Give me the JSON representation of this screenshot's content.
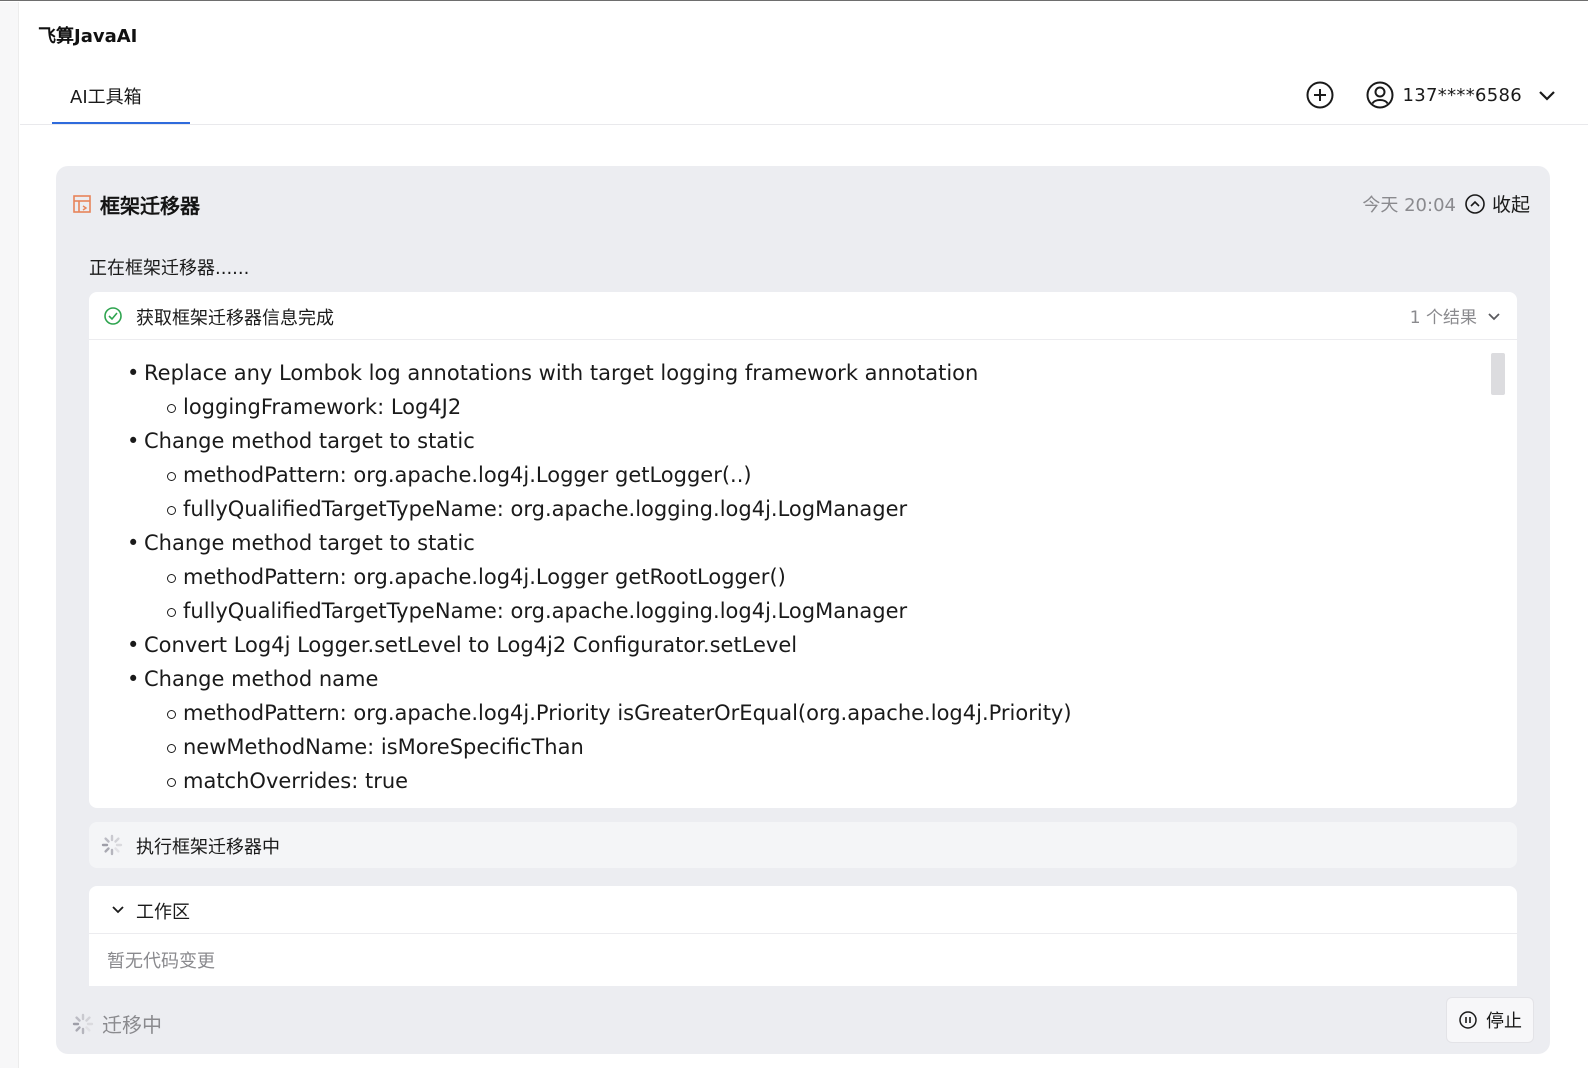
{
  "app": {
    "title": "飞算JavaAI"
  },
  "tabs": [
    {
      "label": "AI工具箱",
      "active": true
    }
  ],
  "header": {
    "new_icon": "plus-circle-icon",
    "user_icon": "user-circle-icon",
    "user_name": "137****6586",
    "menu_icon": "chevron-down-icon"
  },
  "panel": {
    "icon": "framework-migrate-icon",
    "title": "框架迁移器",
    "timestamp": "今天 20:04",
    "collapse_label": "收起",
    "status_text": "正在框架迁移器......",
    "result": {
      "title": "获取框架迁移器信息完成",
      "count_label": "1 个结果",
      "rules": [
        {
          "title": "Replace any Lombok log annotations with target logging framework annotation",
          "params": [
            "loggingFramework: Log4J2"
          ]
        },
        {
          "title": "Change method target to static",
          "params": [
            "methodPattern: org.apache.log4j.Logger getLogger(..)",
            "fullyQualifiedTargetTypeName: org.apache.logging.log4j.LogManager"
          ]
        },
        {
          "title": "Change method target to static",
          "params": [
            "methodPattern: org.apache.log4j.Logger getRootLogger()",
            "fullyQualifiedTargetTypeName: org.apache.logging.log4j.LogManager"
          ]
        },
        {
          "title": "Convert Log4j Logger.setLevel to Log4j2 Configurator.setLevel",
          "params": []
        },
        {
          "title": "Change method name",
          "params": [
            "methodPattern: org.apache.log4j.Priority isGreaterOrEqual(org.apache.log4j.Priority)",
            "newMethodName: isMoreSpecificThan",
            "matchOverrides: true"
          ]
        }
      ]
    },
    "exec_label": "执行框架迁移器中",
    "workspace": {
      "label": "工作区",
      "empty_text": "暂无代码变更"
    },
    "footer_status": "迁移中",
    "stop_label": "停止"
  },
  "colors": {
    "accent": "#2f6bdc",
    "success": "#2ea44f",
    "panel_bg": "#ecedf1",
    "muted": "#8a8a8e"
  }
}
